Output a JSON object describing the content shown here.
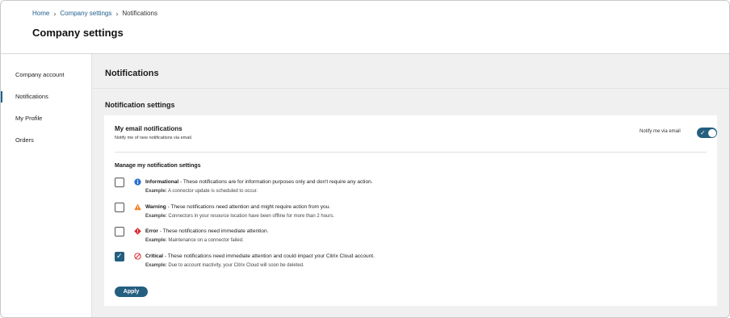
{
  "breadcrumb": {
    "home": "Home",
    "company": "Company settings",
    "current": "Notifications"
  },
  "page_title": "Company settings",
  "sidebar": {
    "items": [
      {
        "label": "Company account"
      },
      {
        "label": "Notifications"
      },
      {
        "label": "My Profile"
      },
      {
        "label": "Orders"
      }
    ]
  },
  "main": {
    "title": "Notifications",
    "subtitle": "Notification settings",
    "email": {
      "title": "My email notifications",
      "description": "Notify me of new notifications via email.",
      "toggle_label": "Notify me via email",
      "toggle_on": true
    },
    "manage_title": "Manage my notification settings",
    "severities": [
      {
        "name": "Informational",
        "desc": " - These notifications are for information purposes only and don't require any action.",
        "example_label": "Example:",
        "example": " A connector update is scheduled to occur.",
        "checked": false,
        "icon": "info-icon"
      },
      {
        "name": "Warning",
        "desc": " - These notifications need attention and might require action from you.",
        "example_label": "Example:",
        "example": " Connectors in your resource location have been offline for more than 2 hours.",
        "checked": false,
        "icon": "warning-icon"
      },
      {
        "name": "Error",
        "desc": " - These notifications need immediate attention.",
        "example_label": "Example:",
        "example": " Maintenance on a connector failed.",
        "checked": false,
        "icon": "error-icon"
      },
      {
        "name": "Critical",
        "desc": " - These notifications need immediate attention and could impact your Citrix Cloud account.",
        "example_label": "Example:",
        "example": " Due to account inactivity, your Citrix Cloud will soon be deleted.",
        "checked": true,
        "icon": "critical-icon"
      }
    ],
    "apply_label": "Apply"
  },
  "colors": {
    "accent": "#245f80",
    "link": "#1f5e8c",
    "info": "#2f6fd1",
    "warning": "#f07c1e",
    "error": "#d9262c",
    "critical": "#d9262c"
  }
}
